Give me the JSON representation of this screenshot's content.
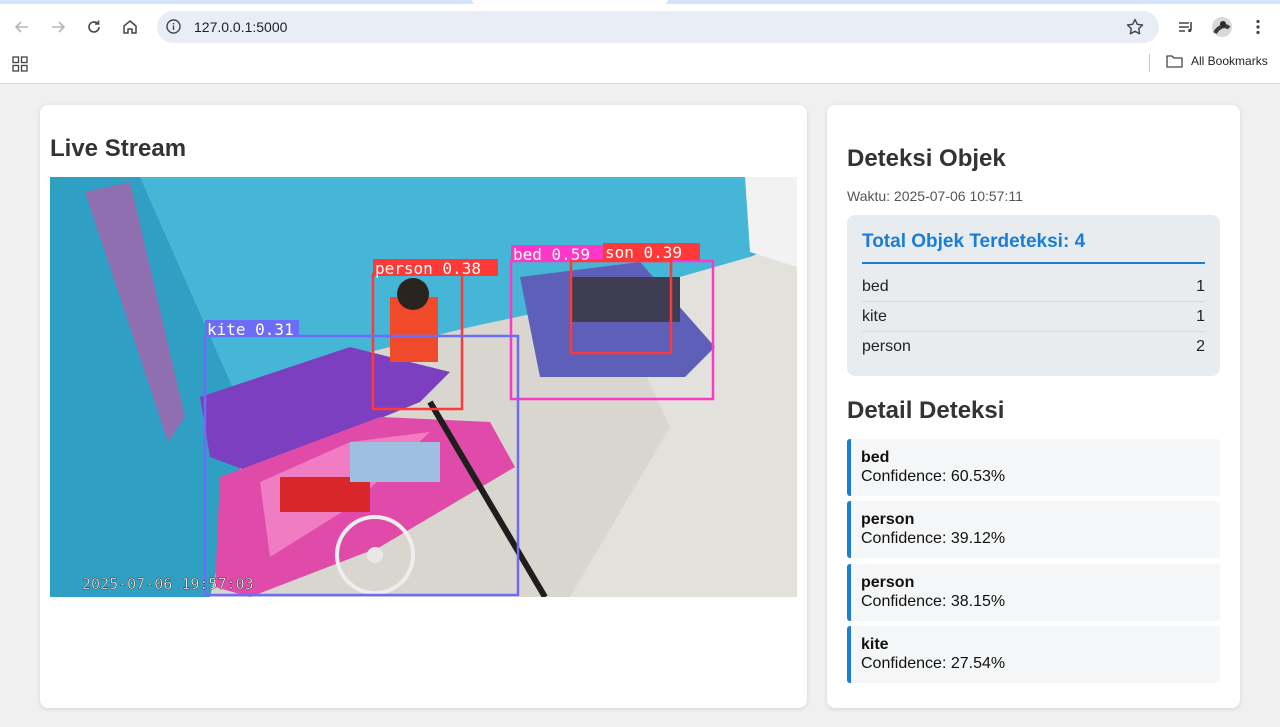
{
  "browser": {
    "url": "127.0.0.1:5000",
    "bookmarks_label": "All Bookmarks"
  },
  "stream": {
    "title": "Live Stream",
    "timestamp_overlay": "2025-07-06 19:57:03",
    "detections": [
      {
        "label": "person 0.38",
        "color": "#ff3838"
      },
      {
        "label": "bed 0.59",
        "color": "#ff37c7"
      },
      {
        "label": "son 0.39",
        "color": "#ff3838"
      },
      {
        "label": "kite 0.31",
        "color": "#6c6cf7"
      }
    ]
  },
  "detection": {
    "title": "Deteksi Objek",
    "time_text": "Waktu: 2025-07-06 10:57:11",
    "summary_title": "Total Objek Terdeteksi: 4",
    "summary": [
      {
        "name": "bed",
        "count": "1"
      },
      {
        "name": "kite",
        "count": "1"
      },
      {
        "name": "person",
        "count": "2"
      }
    ],
    "detail_title": "Detail Deteksi",
    "details": [
      {
        "label": "bed",
        "confidence": "Confidence: 60.53%"
      },
      {
        "label": "person",
        "confidence": "Confidence: 39.12%"
      },
      {
        "label": "person",
        "confidence": "Confidence: 38.15%"
      },
      {
        "label": "kite",
        "confidence": "Confidence: 27.54%"
      }
    ]
  },
  "colors": {
    "accent": "#1a7fd4",
    "person_box": "#ff3838",
    "bed_box": "#ff37c7",
    "kite_box": "#6c6cf7"
  },
  "icons": [
    "back-arrow-icon",
    "forward-arrow-icon",
    "reload-icon",
    "home-icon",
    "site-info-icon",
    "bookmark-star-icon",
    "reading-list-icon",
    "profile-avatar",
    "menu-kebab-icon",
    "apps-grid-icon",
    "folder-icon"
  ]
}
